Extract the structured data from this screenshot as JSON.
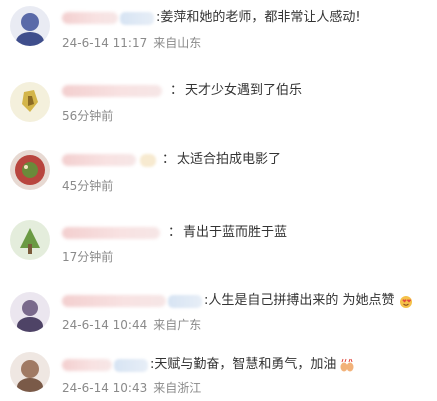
{
  "comments": [
    {
      "text": "姜萍和她的老师，都非常让人感动!",
      "time": "24-6-14 11:17",
      "location": "来自山东",
      "avatar_color": "#4a5a9a"
    },
    {
      "text": "天才少女遇到了伯乐",
      "time": "56分钟前",
      "location": "",
      "avatar_color": "#c9b24a"
    },
    {
      "text": "太适合拍成电影了",
      "time": "45分钟前",
      "location": "",
      "avatar_color": "#b9423c"
    },
    {
      "text": "青出于蓝而胜于蓝",
      "time": "17分钟前",
      "location": "",
      "avatar_color": "#5a8a3a"
    },
    {
      "text": "人生是自己拼搏出来的 为她点赞",
      "time": "24-6-14 10:44",
      "location": "来自广东",
      "avatar_color": "#6a5a7a"
    },
    {
      "text": "天赋与勤奋，智慧和勇气，加油",
      "time": "24-6-14 10:43",
      "location": "来自浙江",
      "avatar_color": "#8a6a5a"
    }
  ],
  "icons": {
    "like_emoji": "heart-face-emoji",
    "cheer_emoji": "raised-hands-emoji"
  }
}
